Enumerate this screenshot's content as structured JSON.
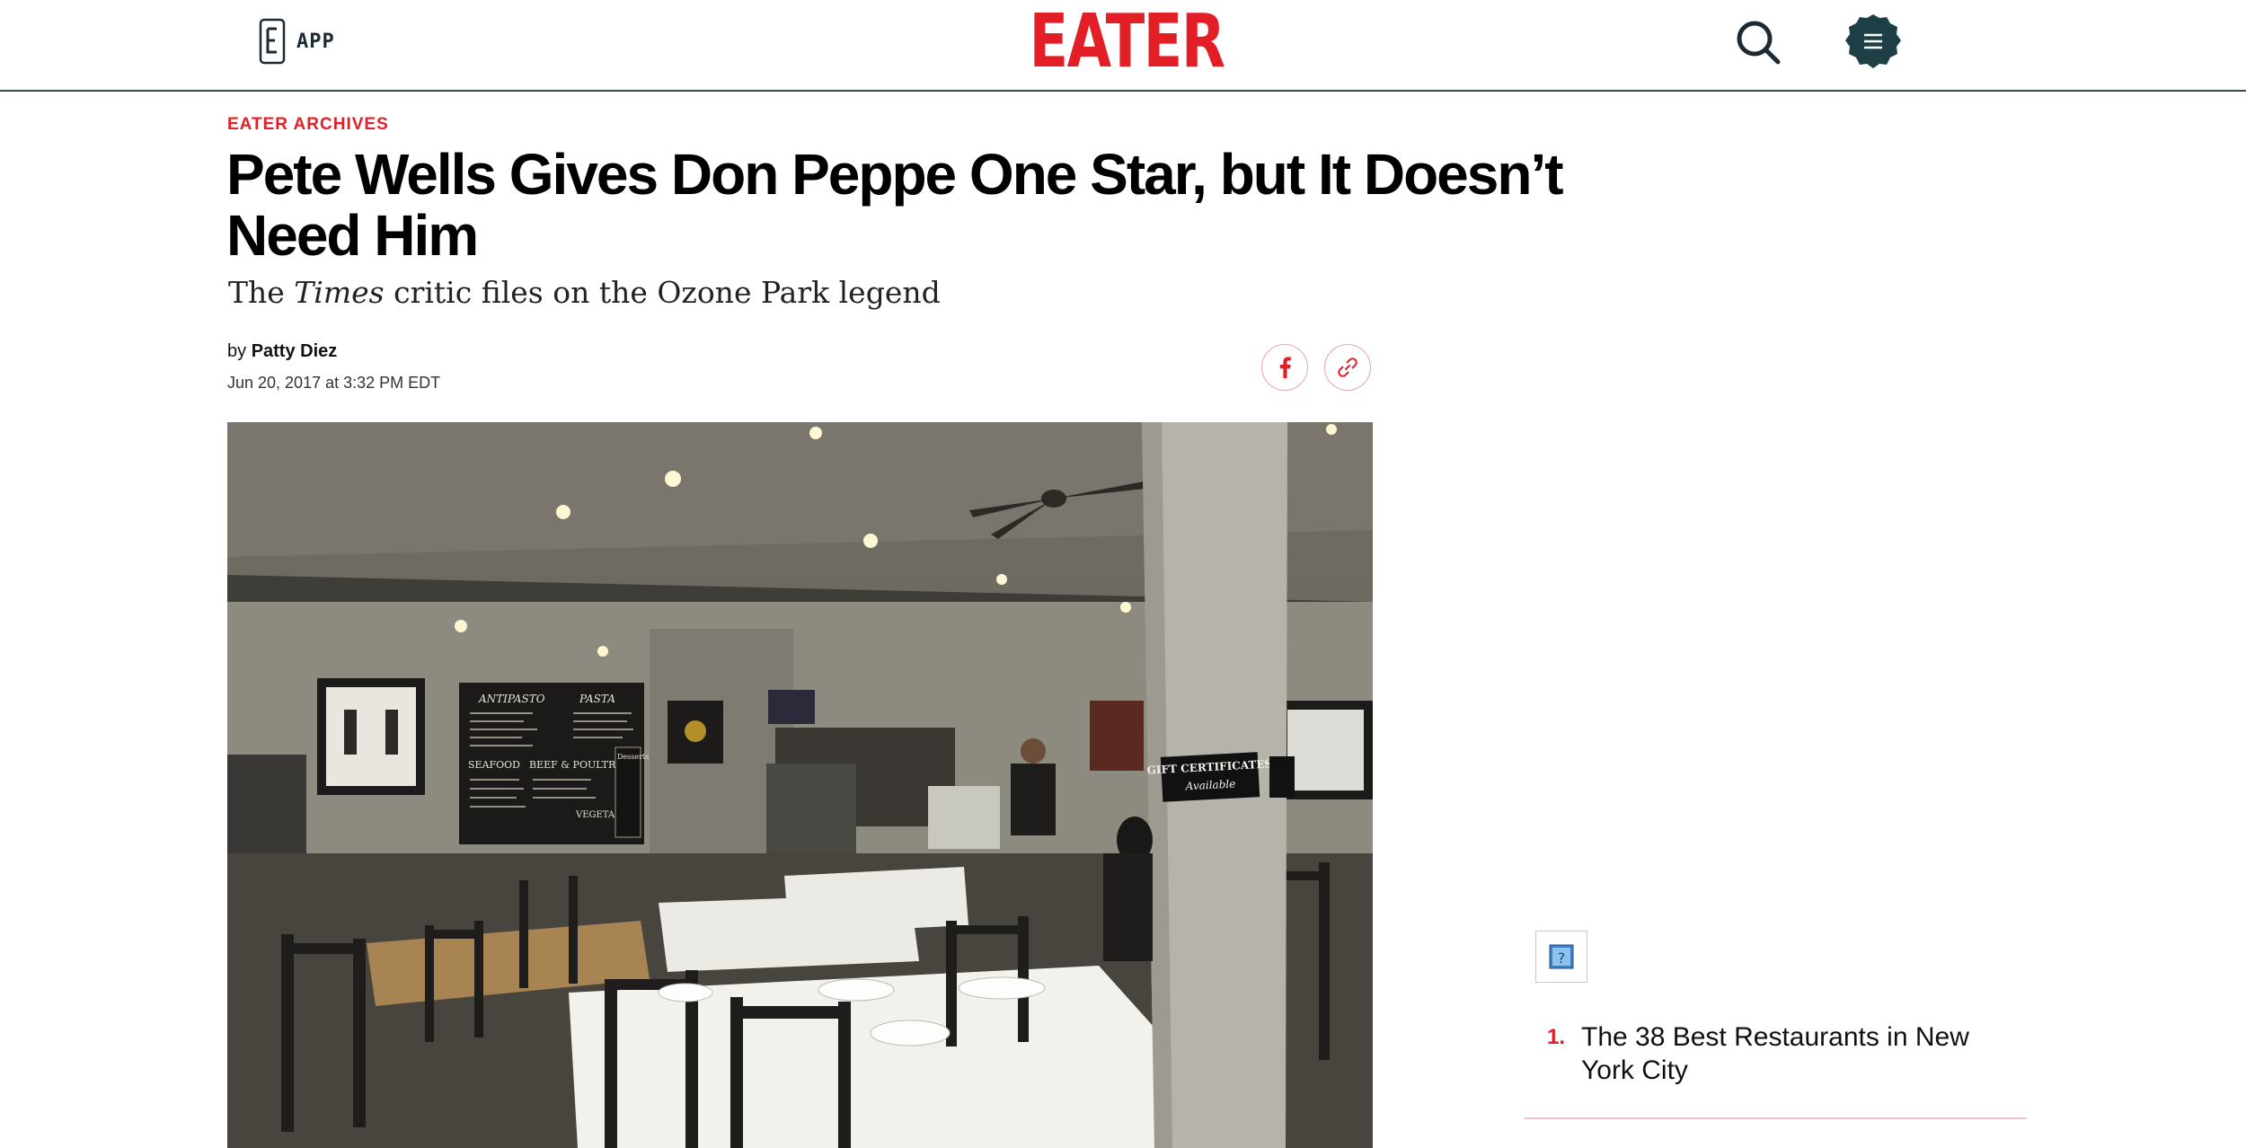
{
  "header": {
    "app_label": "APP",
    "logo_text": "EATER",
    "brand_color": "#e21f26",
    "dark_color": "#1c2b33",
    "icons": [
      "phone-app-icon",
      "search-icon",
      "menu-icon"
    ]
  },
  "article": {
    "kicker": "EATER ARCHIVES",
    "headline": "Pete Wells Gives Don Peppe One Star, but It Doesn’t Need Him",
    "dek_prefix": "The ",
    "dek_italic": "Times",
    "dek_suffix": " critic files on the Ozone Park legend",
    "byline_prefix": "by ",
    "author": "Patty Diez",
    "timestamp": "Jun 20, 2017 at 3:32 PM EDT",
    "share_icons": [
      "facebook-icon",
      "link-icon"
    ]
  },
  "hero_image": {
    "menu_board": {
      "antipasto": "ANTIPASTO",
      "pasta": "PASTA",
      "seafood": "SEAFOOD",
      "beef_poultry": "BEEF & POULTRY",
      "desserts": "Desserts",
      "vegetables": "VEGETABLES"
    },
    "pillar_sign_line1": "GIFT CERTIFICATES",
    "pillar_sign_line2": "Available"
  },
  "sidebar": {
    "popular": [
      {
        "number": "1.",
        "title": "The 38 Best Restaurants in New York City"
      }
    ]
  }
}
